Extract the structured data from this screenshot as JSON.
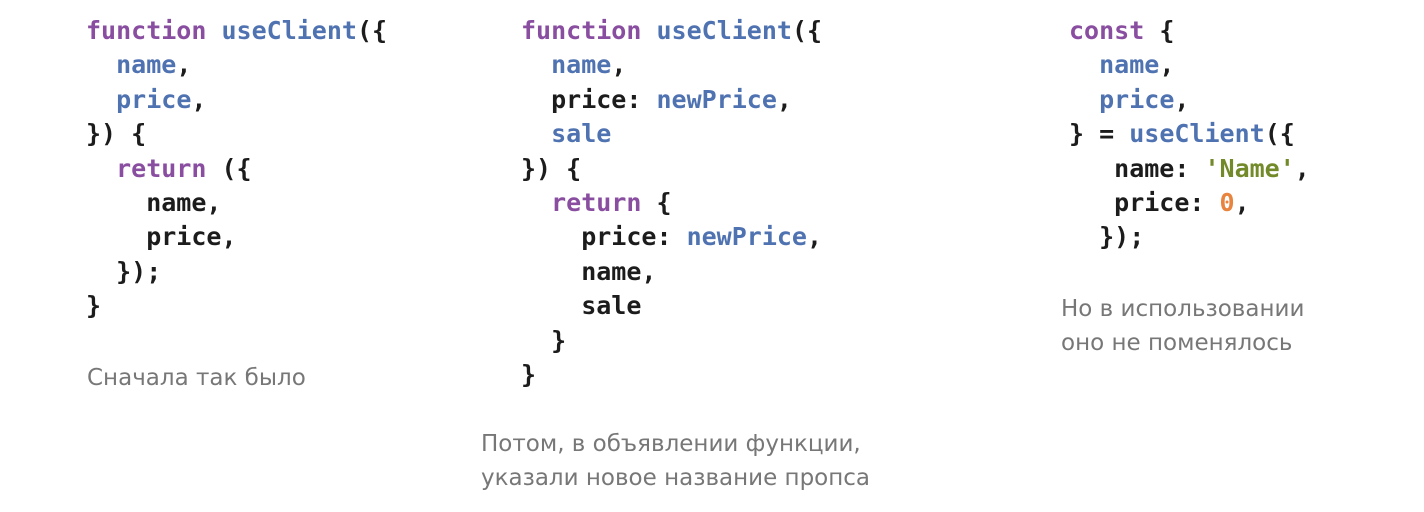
{
  "panels": [
    {
      "lines": [
        [
          [
            "keyword",
            "function"
          ],
          [
            "plain",
            " "
          ],
          [
            "name",
            "useClient"
          ],
          [
            "punct",
            "({"
          ]
        ],
        [
          [
            "plain",
            "  "
          ],
          [
            "name",
            "name"
          ],
          [
            "punct",
            ","
          ]
        ],
        [
          [
            "plain",
            "  "
          ],
          [
            "name",
            "price"
          ],
          [
            "punct",
            ","
          ]
        ],
        [
          [
            "punct",
            "}) {"
          ]
        ],
        [
          [
            "plain",
            "  "
          ],
          [
            "keyword",
            "return"
          ],
          [
            "punct",
            " ({"
          ]
        ],
        [
          [
            "plain",
            "    name,"
          ]
        ],
        [
          [
            "plain",
            "    price,"
          ]
        ],
        [
          [
            "punct",
            "  });"
          ]
        ],
        [
          [
            "punct",
            "}"
          ]
        ]
      ],
      "caption": "Сначала так было"
    },
    {
      "lines": [
        [
          [
            "keyword",
            "function"
          ],
          [
            "plain",
            " "
          ],
          [
            "name",
            "useClient"
          ],
          [
            "punct",
            "({"
          ]
        ],
        [
          [
            "plain",
            "  "
          ],
          [
            "name",
            "name"
          ],
          [
            "punct",
            ","
          ]
        ],
        [
          [
            "plain",
            "  price: "
          ],
          [
            "name",
            "newPrice"
          ],
          [
            "punct",
            ","
          ]
        ],
        [
          [
            "plain",
            "  "
          ],
          [
            "name",
            "sale"
          ]
        ],
        [
          [
            "punct",
            "}) {"
          ]
        ],
        [
          [
            "plain",
            "  "
          ],
          [
            "keyword",
            "return"
          ],
          [
            "punct",
            " {"
          ]
        ],
        [
          [
            "plain",
            "    price: "
          ],
          [
            "name",
            "newPrice"
          ],
          [
            "punct",
            ","
          ]
        ],
        [
          [
            "plain",
            "    name,"
          ]
        ],
        [
          [
            "plain",
            "    sale"
          ]
        ],
        [
          [
            "punct",
            "  }"
          ]
        ],
        [
          [
            "punct",
            "}"
          ]
        ]
      ],
      "caption": "Потом, в объявлении функции,\nуказали новое название пропса"
    },
    {
      "lines": [
        [
          [
            "keyword",
            "const"
          ],
          [
            "punct",
            " {"
          ]
        ],
        [
          [
            "plain",
            "  "
          ],
          [
            "name",
            "name"
          ],
          [
            "punct",
            ","
          ]
        ],
        [
          [
            "plain",
            "  "
          ],
          [
            "name",
            "price"
          ],
          [
            "punct",
            ","
          ]
        ],
        [
          [
            "punct",
            "} = "
          ],
          [
            "name",
            "useClient"
          ],
          [
            "punct",
            "({"
          ]
        ],
        [
          [
            "plain",
            "   name: "
          ],
          [
            "string",
            "'Name'"
          ],
          [
            "punct",
            ","
          ]
        ],
        [
          [
            "plain",
            "   price: "
          ],
          [
            "number",
            "0"
          ],
          [
            "punct",
            ","
          ]
        ],
        [
          [
            "punct",
            "  });"
          ]
        ]
      ],
      "caption": "Но в использовании\nоно не поменялось"
    }
  ],
  "colors": {
    "keyword": "#8a4ea1",
    "name": "#4f72b1",
    "string": "#738a2a",
    "number": "#e8843d",
    "plain": "#1c1c1c",
    "caption": "#777777",
    "background": "#ffffff"
  }
}
